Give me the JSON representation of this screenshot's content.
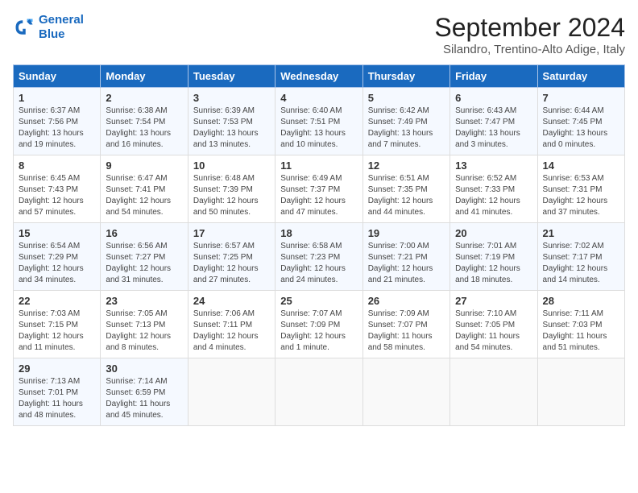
{
  "logo": {
    "line1": "General",
    "line2": "Blue"
  },
  "title": "September 2024",
  "subtitle": "Silandro, Trentino-Alto Adige, Italy",
  "days_of_week": [
    "Sunday",
    "Monday",
    "Tuesday",
    "Wednesday",
    "Thursday",
    "Friday",
    "Saturday"
  ],
  "weeks": [
    [
      {
        "day": "1",
        "content": "Sunrise: 6:37 AM\nSunset: 7:56 PM\nDaylight: 13 hours\nand 19 minutes."
      },
      {
        "day": "2",
        "content": "Sunrise: 6:38 AM\nSunset: 7:54 PM\nDaylight: 13 hours\nand 16 minutes."
      },
      {
        "day": "3",
        "content": "Sunrise: 6:39 AM\nSunset: 7:53 PM\nDaylight: 13 hours\nand 13 minutes."
      },
      {
        "day": "4",
        "content": "Sunrise: 6:40 AM\nSunset: 7:51 PM\nDaylight: 13 hours\nand 10 minutes."
      },
      {
        "day": "5",
        "content": "Sunrise: 6:42 AM\nSunset: 7:49 PM\nDaylight: 13 hours\nand 7 minutes."
      },
      {
        "day": "6",
        "content": "Sunrise: 6:43 AM\nSunset: 7:47 PM\nDaylight: 13 hours\nand 3 minutes."
      },
      {
        "day": "7",
        "content": "Sunrise: 6:44 AM\nSunset: 7:45 PM\nDaylight: 13 hours\nand 0 minutes."
      }
    ],
    [
      {
        "day": "8",
        "content": "Sunrise: 6:45 AM\nSunset: 7:43 PM\nDaylight: 12 hours\nand 57 minutes."
      },
      {
        "day": "9",
        "content": "Sunrise: 6:47 AM\nSunset: 7:41 PM\nDaylight: 12 hours\nand 54 minutes."
      },
      {
        "day": "10",
        "content": "Sunrise: 6:48 AM\nSunset: 7:39 PM\nDaylight: 12 hours\nand 50 minutes."
      },
      {
        "day": "11",
        "content": "Sunrise: 6:49 AM\nSunset: 7:37 PM\nDaylight: 12 hours\nand 47 minutes."
      },
      {
        "day": "12",
        "content": "Sunrise: 6:51 AM\nSunset: 7:35 PM\nDaylight: 12 hours\nand 44 minutes."
      },
      {
        "day": "13",
        "content": "Sunrise: 6:52 AM\nSunset: 7:33 PM\nDaylight: 12 hours\nand 41 minutes."
      },
      {
        "day": "14",
        "content": "Sunrise: 6:53 AM\nSunset: 7:31 PM\nDaylight: 12 hours\nand 37 minutes."
      }
    ],
    [
      {
        "day": "15",
        "content": "Sunrise: 6:54 AM\nSunset: 7:29 PM\nDaylight: 12 hours\nand 34 minutes."
      },
      {
        "day": "16",
        "content": "Sunrise: 6:56 AM\nSunset: 7:27 PM\nDaylight: 12 hours\nand 31 minutes."
      },
      {
        "day": "17",
        "content": "Sunrise: 6:57 AM\nSunset: 7:25 PM\nDaylight: 12 hours\nand 27 minutes."
      },
      {
        "day": "18",
        "content": "Sunrise: 6:58 AM\nSunset: 7:23 PM\nDaylight: 12 hours\nand 24 minutes."
      },
      {
        "day": "19",
        "content": "Sunrise: 7:00 AM\nSunset: 7:21 PM\nDaylight: 12 hours\nand 21 minutes."
      },
      {
        "day": "20",
        "content": "Sunrise: 7:01 AM\nSunset: 7:19 PM\nDaylight: 12 hours\nand 18 minutes."
      },
      {
        "day": "21",
        "content": "Sunrise: 7:02 AM\nSunset: 7:17 PM\nDaylight: 12 hours\nand 14 minutes."
      }
    ],
    [
      {
        "day": "22",
        "content": "Sunrise: 7:03 AM\nSunset: 7:15 PM\nDaylight: 12 hours\nand 11 minutes."
      },
      {
        "day": "23",
        "content": "Sunrise: 7:05 AM\nSunset: 7:13 PM\nDaylight: 12 hours\nand 8 minutes."
      },
      {
        "day": "24",
        "content": "Sunrise: 7:06 AM\nSunset: 7:11 PM\nDaylight: 12 hours\nand 4 minutes."
      },
      {
        "day": "25",
        "content": "Sunrise: 7:07 AM\nSunset: 7:09 PM\nDaylight: 12 hours\nand 1 minute."
      },
      {
        "day": "26",
        "content": "Sunrise: 7:09 AM\nSunset: 7:07 PM\nDaylight: 11 hours\nand 58 minutes."
      },
      {
        "day": "27",
        "content": "Sunrise: 7:10 AM\nSunset: 7:05 PM\nDaylight: 11 hours\nand 54 minutes."
      },
      {
        "day": "28",
        "content": "Sunrise: 7:11 AM\nSunset: 7:03 PM\nDaylight: 11 hours\nand 51 minutes."
      }
    ],
    [
      {
        "day": "29",
        "content": "Sunrise: 7:13 AM\nSunset: 7:01 PM\nDaylight: 11 hours\nand 48 minutes."
      },
      {
        "day": "30",
        "content": "Sunrise: 7:14 AM\nSunset: 6:59 PM\nDaylight: 11 hours\nand 45 minutes."
      },
      {
        "day": "",
        "content": ""
      },
      {
        "day": "",
        "content": ""
      },
      {
        "day": "",
        "content": ""
      },
      {
        "day": "",
        "content": ""
      },
      {
        "day": "",
        "content": ""
      }
    ]
  ]
}
